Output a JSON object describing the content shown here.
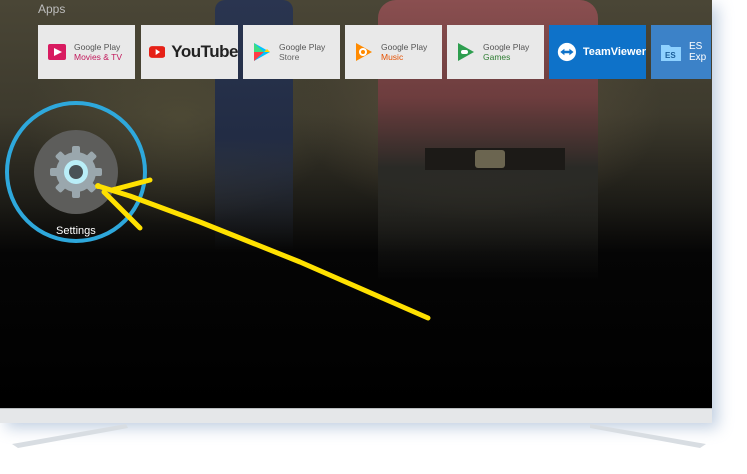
{
  "section_title": "Apps",
  "apps": [
    {
      "name": "Google Play Movies & TV",
      "line1": "Google Play",
      "line2": "Movies & TV",
      "line2_color": "#c2185b"
    },
    {
      "name": "YouTube",
      "line1": "YouTube"
    },
    {
      "name": "Google Play Store",
      "line1": "Google Play",
      "line2": "Store",
      "line2_color": "#666666"
    },
    {
      "name": "Google Play Music",
      "line1": "Google Play",
      "line2": "Music",
      "line2_color": "#e65100"
    },
    {
      "name": "Google Play Games",
      "line1": "Google Play",
      "line2": "Games",
      "line2_color": "#2e7d32"
    },
    {
      "name": "TeamViewer",
      "line1": "TeamViewer",
      "bg": "#0e72c9"
    },
    {
      "name": "ES File Explorer",
      "line1": "ES",
      "line2": "Exp",
      "bg": "#3c82c8"
    }
  ],
  "focused_app": {
    "label": "Settings"
  },
  "colors": {
    "highlight_ring": "#2ea8dc",
    "arrow": "#ffe100"
  }
}
